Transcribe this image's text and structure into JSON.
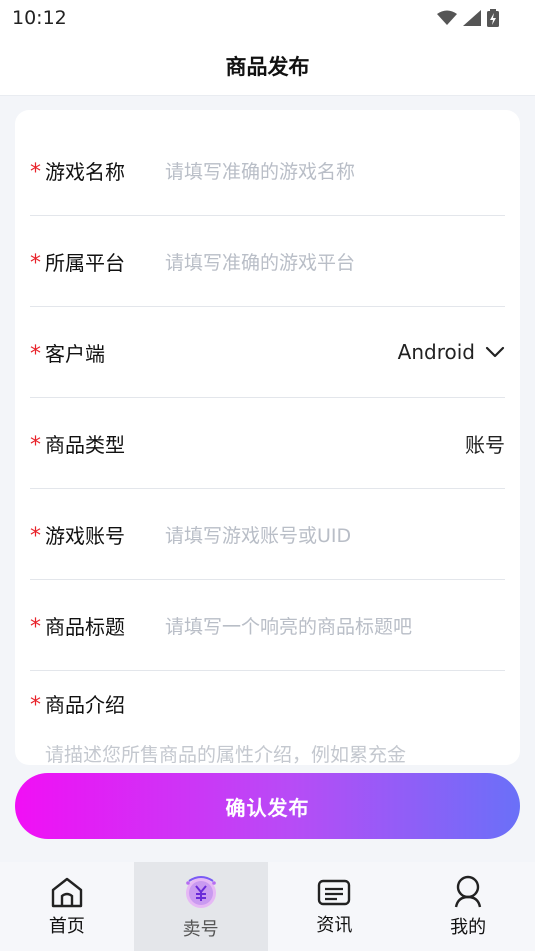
{
  "status_bar": {
    "time": "10:12"
  },
  "header": {
    "title": "商品发布"
  },
  "form": {
    "required_mark": "*",
    "game_name": {
      "label": "游戏名称",
      "placeholder": "请填写准确的游戏名称"
    },
    "platform": {
      "label": "所属平台",
      "placeholder": "请填写准确的游戏平台"
    },
    "client": {
      "label": "客户端",
      "value": "Android"
    },
    "product_type": {
      "label": "商品类型",
      "value": "账号"
    },
    "game_account": {
      "label": "游戏账号",
      "placeholder": "请填写游戏账号或UID"
    },
    "product_title": {
      "label": "商品标题",
      "placeholder": "请填写一个响亮的商品标题吧"
    },
    "product_intro": {
      "label": "商品介绍",
      "placeholder": "请描述您所售商品的属性介绍，例如累充金"
    }
  },
  "confirm_button": {
    "label": "确认发布"
  },
  "tabbar": {
    "items": [
      {
        "label": "首页",
        "icon": "home-icon",
        "active": false
      },
      {
        "label": "卖号",
        "icon": "yen-sell-icon",
        "active": true
      },
      {
        "label": "资讯",
        "icon": "news-icon",
        "active": false
      },
      {
        "label": "我的",
        "icon": "profile-icon",
        "active": false
      }
    ]
  },
  "colors": {
    "required": "#e8232b",
    "placeholder": "#b9bec7",
    "gradient_start": "#f10ff5",
    "gradient_end": "#6a70f8"
  }
}
